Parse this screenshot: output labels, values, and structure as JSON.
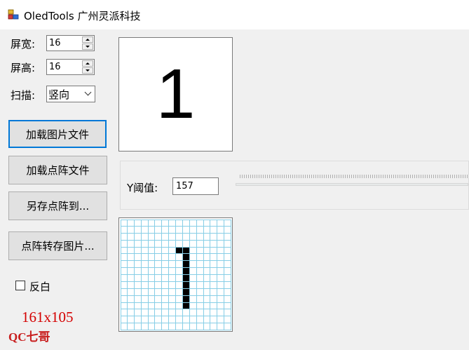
{
  "window": {
    "title": "OledTools 广州灵派科技"
  },
  "form": {
    "width_label": "屏宽:",
    "width_value": "16",
    "height_label": "屏高:",
    "height_value": "16",
    "scan_label": "扫描:",
    "scan_value": "竖向"
  },
  "buttons": {
    "load_image": "加载图片文件",
    "load_matrix": "加载点阵文件",
    "save_matrix_as": "另存点阵到...",
    "matrix_to_image": "点阵转存图片..."
  },
  "preview": {
    "glyph": "1"
  },
  "threshold": {
    "label": "Y阈值:",
    "value": "157"
  },
  "matrix": {
    "rows": 16,
    "cols": 16,
    "on_cells": [
      [
        4,
        8
      ],
      [
        4,
        9
      ],
      [
        5,
        9
      ],
      [
        6,
        9
      ],
      [
        7,
        9
      ],
      [
        8,
        9
      ],
      [
        9,
        9
      ],
      [
        10,
        9
      ],
      [
        11,
        9
      ],
      [
        12,
        9
      ]
    ]
  },
  "invert": {
    "label": "反白",
    "checked": false
  },
  "overlay": {
    "size_label": "161x105",
    "watermark": "QC七哥"
  }
}
